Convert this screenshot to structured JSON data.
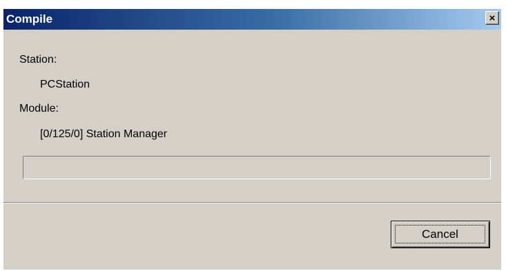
{
  "dialog": {
    "title": "Compile",
    "close_glyph": "×",
    "close_icon": "close-icon"
  },
  "content": {
    "station_label": "Station:",
    "station_value": "PCStation",
    "module_label": "Module:",
    "module_value": "[0/125/0] Station Manager",
    "progress_percent": 0
  },
  "buttons": {
    "cancel_label": "Cancel"
  },
  "colors": {
    "titlebar_start": "#0a246a",
    "titlebar_end": "#a6caf0",
    "window_face": "#d4d0c8"
  }
}
